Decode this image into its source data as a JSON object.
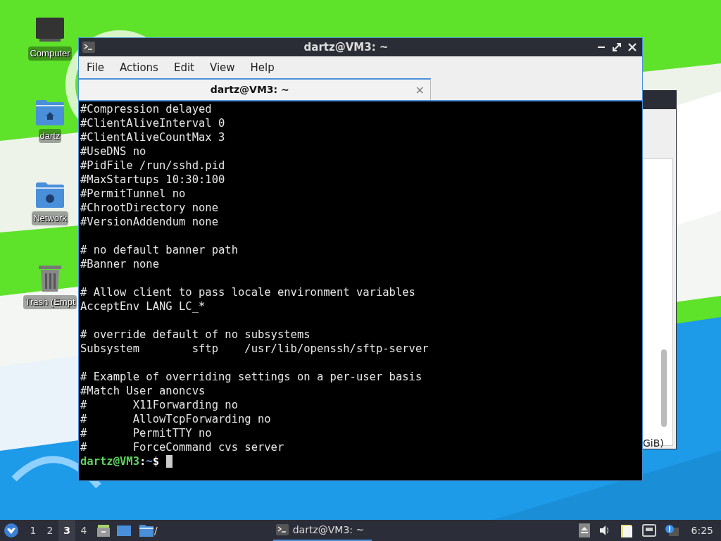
{
  "desktop_icons": [
    {
      "label": "Computer",
      "kind": "computer"
    },
    {
      "label": "dartz",
      "kind": "home"
    },
    {
      "label": "Network",
      "kind": "network"
    },
    {
      "label": "Trash (Empt",
      "kind": "trash"
    }
  ],
  "background_window": {
    "status_text": "GiB)"
  },
  "terminal": {
    "title": "dartz@VM3: ~",
    "menu": [
      "File",
      "Actions",
      "Edit",
      "View",
      "Help"
    ],
    "tabs": [
      {
        "label": "dartz@VM3: ~",
        "selected": true,
        "close": "×"
      }
    ],
    "blocks": [
      [
        "#Compression delayed",
        "#ClientAliveInterval 0",
        "#ClientAliveCountMax 3",
        "#UseDNS no",
        "#PidFile /run/sshd.pid",
        "#MaxStartups 10:30:100",
        "#PermitTunnel no",
        "#ChrootDirectory none",
        "#VersionAddendum none"
      ],
      [
        "# no default banner path",
        "#Banner none"
      ],
      [
        "# Allow client to pass locale environment variables",
        "AcceptEnv LANG LC_*"
      ],
      [
        "# override default of no subsystems",
        "Subsystem        sftp    /usr/lib/openssh/sftp-server"
      ],
      [
        "# Example of overriding settings on a per-user basis",
        "#Match User anoncvs",
        "#       X11Forwarding no",
        "#       AllowTcpForwarding no",
        "#       PermitTTY no",
        "#       ForceCommand cvs server"
      ]
    ],
    "prompt": {
      "user_host": "dartz@VM3",
      "colon": ":",
      "path": "~",
      "symbol": "$"
    }
  },
  "taskbar": {
    "workspaces": [
      {
        "label": "1",
        "selected": false
      },
      {
        "label": "2",
        "selected": false
      },
      {
        "label": "3",
        "selected": true
      },
      {
        "label": "4",
        "selected": false
      }
    ],
    "folder_label": "/",
    "tasks": [
      {
        "label": "dartz@VM3: ~",
        "selected": true
      }
    ],
    "clock": "6:25"
  }
}
